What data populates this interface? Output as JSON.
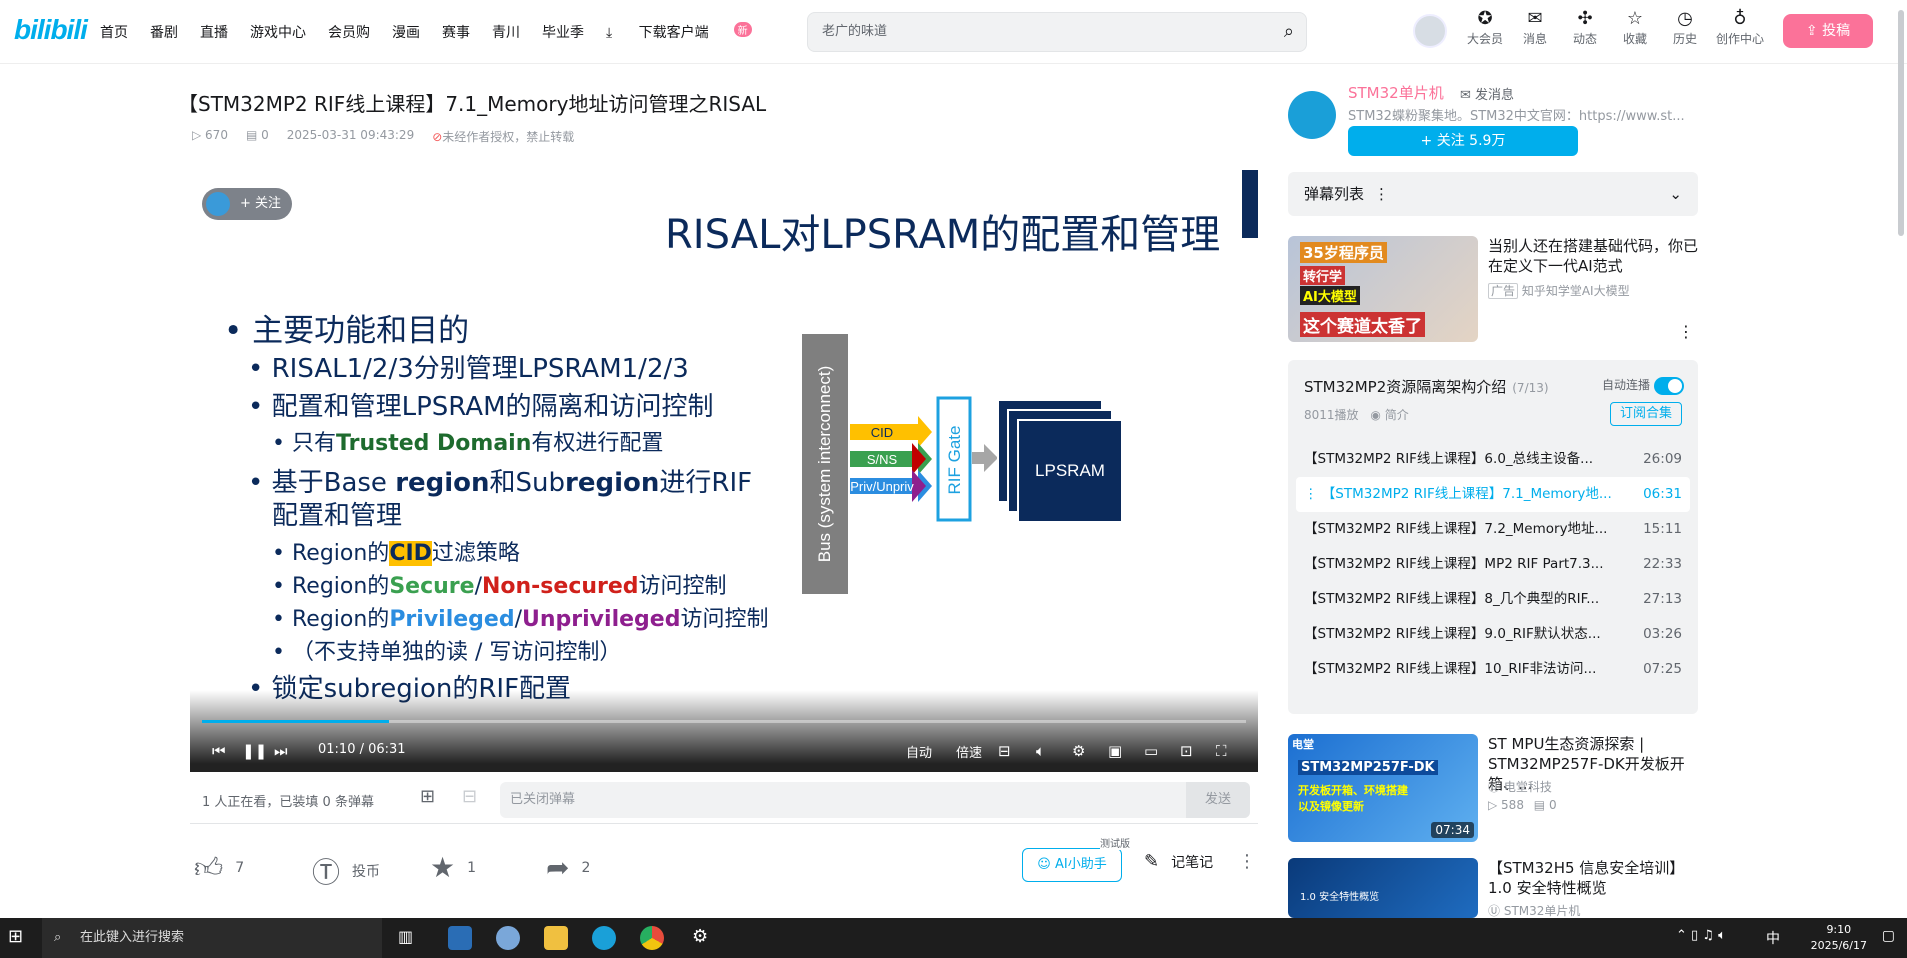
{
  "header": {
    "logo": "bilibili",
    "nav": [
      "首页",
      "番剧",
      "直播",
      "游戏中心",
      "会员购",
      "漫画",
      "赛事",
      "青川",
      "毕业季",
      "下载客户端"
    ],
    "nav_badge": "新",
    "search_placeholder": "老广的味道",
    "icons": [
      {
        "label": "大会员",
        "icon": "vip-icon"
      },
      {
        "label": "消息",
        "icon": "message-icon"
      },
      {
        "label": "动态",
        "icon": "dynamic-icon"
      },
      {
        "label": "收藏",
        "icon": "star-icon"
      },
      {
        "label": "历史",
        "icon": "history-icon"
      },
      {
        "label": "创作中心",
        "icon": "creator-icon"
      }
    ],
    "upload": "投稿"
  },
  "video": {
    "title": "【STM32MP2 RIF线上课程】7.1_Memory地址访问管理之RISAL",
    "views": "670",
    "danmaku": "0",
    "date": "2025-03-31 09:43:29",
    "copyright": "未经作者授权，禁止转载"
  },
  "slide": {
    "follow": "关注",
    "title": "RISAL对LPSRAM的配置和管理",
    "b1": "主要功能和目的",
    "b2": "RISAL1/2/3分别管理LPSRAM1/2/3",
    "b3": "配置和管理LPSRAM的隔离和访问控制",
    "b4a": "只有",
    "b4b": "Trusted Domain",
    "b4c": "有权进行配置",
    "b5a": "基于Base ",
    "b5b": "region",
    "b5c": "和Sub",
    "b5d": "region",
    "b5e": "进行RIF",
    "b5f": "配置和管理",
    "b6a": "Region的",
    "b6b": "CID",
    "b6c": "过滤策略",
    "b7a": "Region的",
    "b7b": "Secure",
    "b7c": "/",
    "b7d": "Non-secured",
    "b7e": "访问控制",
    "b8a": "Region的",
    "b8b": "Privileged",
    "b8c": "/",
    "b8d": "Unprivileged",
    "b8e": "访问控制",
    "b9": "（不支持单独的读 / 写访问控制）",
    "b10": "锁定subregion的RIF配置",
    "bus": "Bus (system interconnect)",
    "cid": "CID",
    "sns": "S/NS",
    "priv": "Priv/Unpriv",
    "gate": "RIF Gate",
    "lpsram": "LPSRAM"
  },
  "player": {
    "time": "01:10 / 06:31",
    "progress": 0.179,
    "auto": "自动",
    "speed": "倍速"
  },
  "danmaku_bar": {
    "watching": "1 人正在看，已装填 0 条弹幕",
    "placeholder": "已关闭弹幕",
    "send": "发送"
  },
  "actions": {
    "like": "7",
    "coin": "投币",
    "fav": "1",
    "share": "2",
    "ai": "AI小助手",
    "ai_tag": "测试版",
    "note": "记笔记"
  },
  "uploader": {
    "name": "STM32单片机",
    "msg": "发消息",
    "desc": "STM32蝶粉聚集地。STM32中文官网：https://www.st...",
    "follow": "关注 5.9万"
  },
  "danmaku_list": "弹幕列表",
  "ad": {
    "title": "当别人还在搭建基础代码，你已在定义下一代AI范式",
    "tag": "广告",
    "source": "知乎知学堂AI大模型",
    "thumb1": "35岁程序员",
    "thumb2": "转行学",
    "thumb3": "AI大模型",
    "thumb4": "这个赛道太香了"
  },
  "playlist": {
    "title": "STM32MP2资源隔离架构介绍",
    "count": "(7/13)",
    "auto": "自动连播",
    "plays": "8011播放",
    "intro": "简介",
    "subscribe": "订阅合集",
    "items": [
      {
        "t": "【STM32MP2 RIF线上课程】6.0_总线主设备...",
        "d": "26:09"
      },
      {
        "t": "【STM32MP2 RIF线上课程】7.1_Memory地...",
        "d": "06:31"
      },
      {
        "t": "【STM32MP2 RIF线上课程】7.2_Memory地址...",
        "d": "15:11"
      },
      {
        "t": "【STM32MP2 RIF线上课程】MP2 RIF Part7.3...",
        "d": "22:33"
      },
      {
        "t": "【STM32MP2 RIF线上课程】8_几个典型的RIF...",
        "d": "27:13"
      },
      {
        "t": "【STM32MP2 RIF线上课程】9.0_RIF默认状态...",
        "d": "03:26"
      },
      {
        "t": "【STM32MP2 RIF线上课程】10_RIF非法访问...",
        "d": "07:25"
      }
    ]
  },
  "rec1": {
    "title": "ST MPU生态资源探索 | STM32MP257F-DK开发板开箱、...",
    "author": "电堂科技",
    "views": "588",
    "dm": "0",
    "duration": "07:34",
    "thumb": "STM32MP257F-DK",
    "thumb2": "开发板开箱、环境搭建",
    "thumb3": "以及镜像更新",
    "corner": "电堂"
  },
  "rec2": {
    "title": "【STM32H5 信息安全培训】1.0 安全特性概览",
    "author": "STM32单片机",
    "thumb": "1.0 安全特性概览"
  },
  "taskbar": {
    "search": "在此键入进行搜索",
    "time": "9:10",
    "date": "2025/6/17",
    "ime": "中"
  },
  "colors": {
    "accent": "#00aeec",
    "pink": "#fb7299",
    "navy": "#0b2a5b"
  }
}
